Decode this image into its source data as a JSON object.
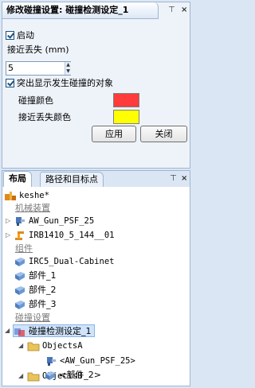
{
  "top_panel": {
    "title": "修改碰撞设置: 碰撞检测设定_1",
    "pin_symbol": "⊤",
    "close_symbol": "×",
    "enable_label": "启动",
    "near_miss_label": "接近丢失 (mm)",
    "near_miss_value": "5",
    "highlight_label": "突出显示发生碰撞的对象",
    "collision_color_label": "碰撞颜色",
    "near_miss_color_label": "接近丢失颜色",
    "apply_label": "应用",
    "close_label": "关闭",
    "colors": {
      "collision": "#ff3b3b",
      "near_miss": "#ffff00"
    }
  },
  "bottom_panel": {
    "tabs": [
      {
        "label": "布局"
      },
      {
        "label": "路径和目标点"
      }
    ],
    "pin_symbol": "⊤",
    "close_symbol": "×",
    "station": "keshe*",
    "groups": {
      "mechanisms": "机械装置",
      "components": "组件",
      "collision": "碰撞设置"
    },
    "mechanisms": [
      "AW_Gun_PSF_25",
      "IRB1410_5_144__01"
    ],
    "components": [
      "IRC5_Dual-Cabinet",
      "部件_1",
      "部件_2",
      "部件_3"
    ],
    "collision_set": "碰撞检测设定_1",
    "objects_a": {
      "label": "ObjectsA",
      "child": "<AW_Gun_PSF_25>"
    },
    "objects_b": {
      "label": "ObjectsB",
      "child": "<部件_2>"
    }
  }
}
